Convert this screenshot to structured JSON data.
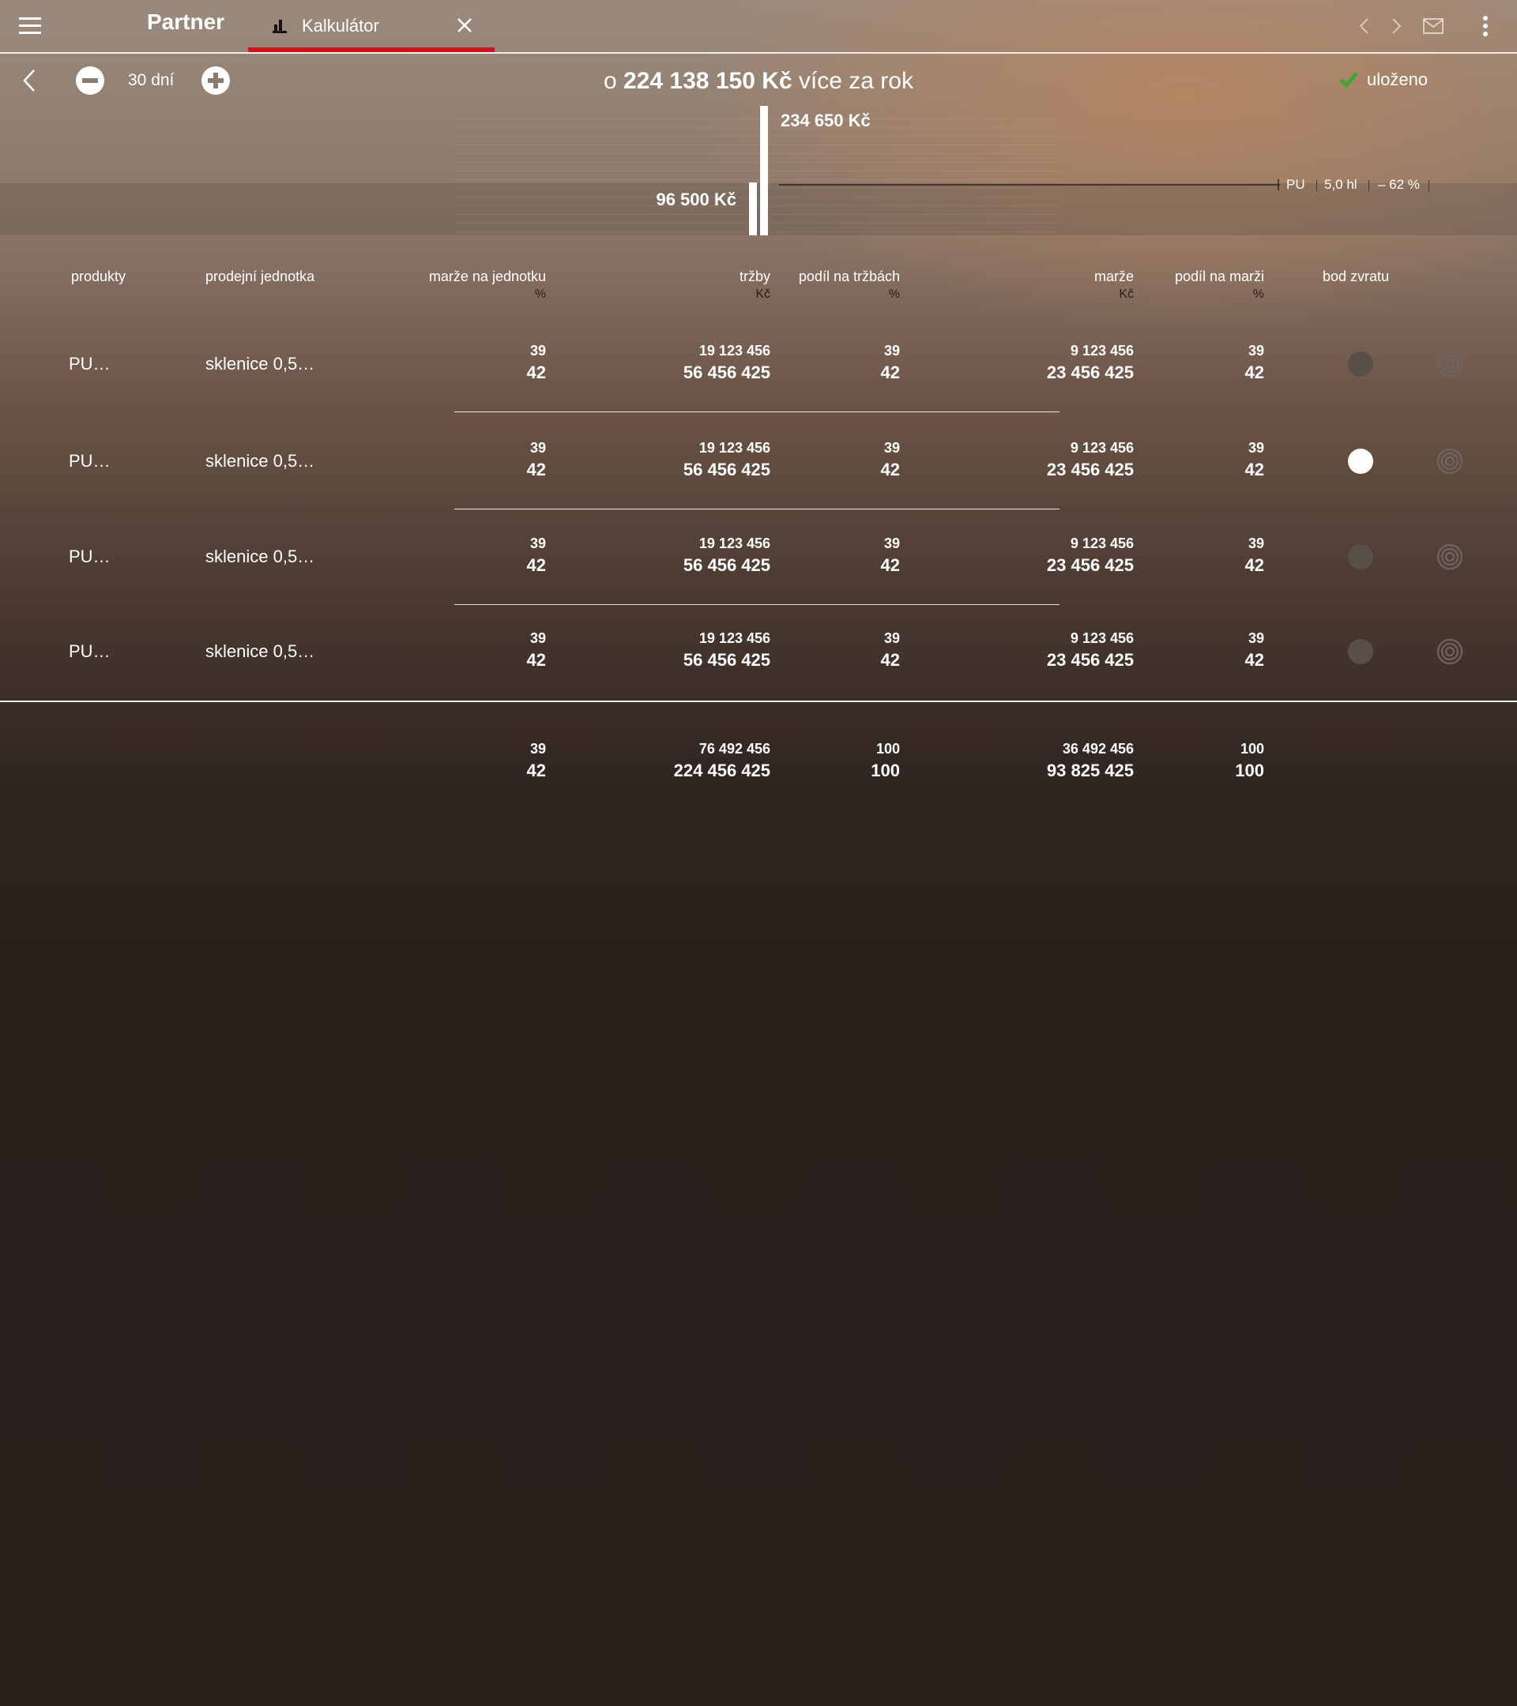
{
  "topbar": {
    "brand": "Partner",
    "tab_label": "Kalkulátor"
  },
  "toolbar": {
    "days": "30 dní",
    "headline_prefix": "o",
    "headline_value": "224 138 150 Kč",
    "headline_suffix": "více za rok",
    "saved_label": "uloženo"
  },
  "chart": {
    "value_top": "234 650 Kč",
    "value_low": "96 500 Kč",
    "marker_product": "PU",
    "marker_volume": "5,0 hl",
    "marker_change": "– 62 %"
  },
  "chart_data": {
    "type": "bar",
    "categories": [
      "",
      ""
    ],
    "values": [
      96500,
      234650
    ],
    "data_labels": [
      "96 500 Kč",
      "234 650 Kč"
    ]
  },
  "table": {
    "headers": {
      "products": "produkty",
      "unit": "prodejní jednotka",
      "margin_per_unit": "marže na jednotku",
      "margin_per_unit_unit": "%",
      "revenue": "tržby",
      "revenue_unit": "Kč",
      "revenue_share": "podíl na tržbách",
      "revenue_share_unit": "%",
      "margin": "marže",
      "margin_unit": "Kč",
      "margin_share": "podíl na marži",
      "margin_share_unit": "%",
      "break_even": "bod zvratu"
    },
    "rows": [
      {
        "product": "PU…",
        "unit": "sklenice 0,5…",
        "mu_small": "39",
        "mu_big": "42",
        "rev_small": "19 123 456",
        "rev_big": "56 456 425",
        "rs_small": "39",
        "rs_big": "42",
        "m_small": "9 123 456",
        "m_big": "23 456 425",
        "ms_small": "39",
        "ms_big": "42",
        "selected": false
      },
      {
        "product": "PU…",
        "unit": "sklenice 0,5…",
        "mu_small": "39",
        "mu_big": "42",
        "rev_small": "19 123 456",
        "rev_big": "56 456 425",
        "rs_small": "39",
        "rs_big": "42",
        "m_small": "9 123 456",
        "m_big": "23 456 425",
        "ms_small": "39",
        "ms_big": "42",
        "selected": true
      },
      {
        "product": "PU…",
        "unit": "sklenice 0,5…",
        "mu_small": "39",
        "mu_big": "42",
        "rev_small": "19 123 456",
        "rev_big": "56 456 425",
        "rs_small": "39",
        "rs_big": "42",
        "m_small": "9 123 456",
        "m_big": "23 456 425",
        "ms_small": "39",
        "ms_big": "42",
        "selected": false
      },
      {
        "product": "PU…",
        "unit": "sklenice 0,5…",
        "mu_small": "39",
        "mu_big": "42",
        "rev_small": "19 123 456",
        "rev_big": "56 456 425",
        "rs_small": "39",
        "rs_big": "42",
        "m_small": "9 123 456",
        "m_big": "23 456 425",
        "ms_small": "39",
        "ms_big": "42",
        "selected": false
      }
    ],
    "totals": {
      "mu_small": "39",
      "mu_big": "42",
      "rev_small": "76 492 456",
      "rev_big": "224 456 425",
      "rs_small": "100",
      "rs_big": "100",
      "m_small": "36 492 456",
      "m_big": "93 825 425",
      "ms_small": "100",
      "ms_big": "100"
    }
  },
  "colors": {
    "accent_red": "#c8141e",
    "check_green": "#3fa535"
  }
}
